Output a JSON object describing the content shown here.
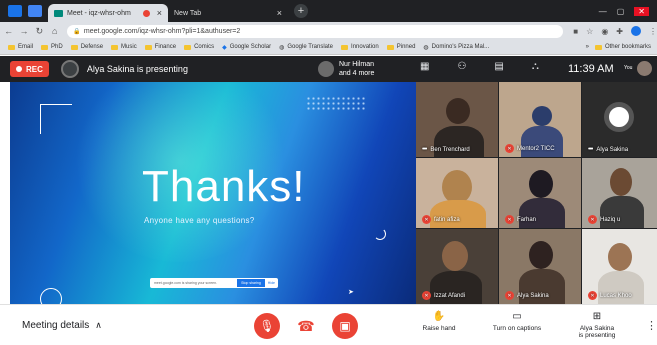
{
  "browser": {
    "tabs": [
      {
        "title": "Meet - iqz-whsr-ohm",
        "active": true
      },
      {
        "title": "New Tab",
        "active": false
      }
    ],
    "url": "meet.google.com/iqz-whsr-ohm?pli=1&authuser=2",
    "bookmarks": [
      "Email",
      "PhD",
      "Defense",
      "Music",
      "Finance",
      "Comics",
      "Google Scholar",
      "Google Translate",
      "Innovation",
      "Pinned",
      "Domino's Pizza Mal..."
    ],
    "other_bookmarks": "Other bookmarks"
  },
  "meet": {
    "rec_label": "REC",
    "presenting_text": "Alya Sakina is presenting",
    "others_line1": "Nur Hilman",
    "others_line2": "and 4 more",
    "clock": "11:39 AM",
    "you_label": "You"
  },
  "slide": {
    "title": "Thanks!",
    "subtitle": "Anyone have any questions?",
    "share_text": "meet.google.com is sharing your screen.",
    "stop_sharing": "Stop sharing",
    "hide": "Hide"
  },
  "participants": [
    {
      "name": "Ben Trenchard",
      "muted": false
    },
    {
      "name": "Mentor2 TICC",
      "muted": true
    },
    {
      "name": "Alya Sakina",
      "muted": false
    },
    {
      "name": "fatin afiza",
      "muted": true
    },
    {
      "name": "Farhan",
      "muted": true
    },
    {
      "name": "Haziq u",
      "muted": true
    },
    {
      "name": "Izzat Afandi",
      "muted": true
    },
    {
      "name": "Alya Sakina",
      "muted": true
    },
    {
      "name": "Lucas Khoo",
      "muted": true
    }
  ],
  "bottom": {
    "meeting_details": "Meeting details",
    "raise_hand": "Raise hand",
    "captions": "Turn on captions",
    "presenting_line1": "Alya Sakina",
    "presenting_line2": "is presenting"
  },
  "colors": {
    "accent_red": "#ea4335",
    "meet_dark": "#202124",
    "brand_blue": "#1a73e8"
  }
}
